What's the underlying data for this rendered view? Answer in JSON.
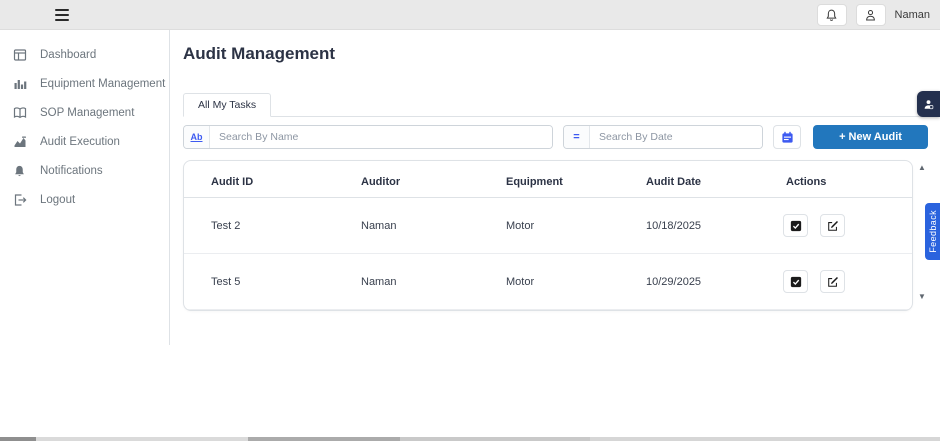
{
  "topbar": {
    "menu_icon": "hamburger-icon",
    "icons": [
      "bell-icon",
      "person-icon"
    ],
    "user_name": "Naman"
  },
  "sidebar": {
    "items": [
      {
        "label": "Dashboard",
        "icon": "dashboard-icon"
      },
      {
        "label": "Equipment Management",
        "icon": "equipment-bars-icon"
      },
      {
        "label": "SOP Management",
        "icon": "open-book-icon"
      },
      {
        "label": "Audit Execution",
        "icon": "audit-chart-icon"
      },
      {
        "label": "Notifications",
        "icon": "bell-filled-icon"
      },
      {
        "label": "Logout",
        "icon": "logout-icon"
      }
    ]
  },
  "main": {
    "title": "Audit Management",
    "tabs": [
      {
        "label": "All My Tasks",
        "active": true
      }
    ],
    "search_name": {
      "prefix": "Ab",
      "placeholder": "Search By Name"
    },
    "search_date": {
      "prefix": "=",
      "placeholder": "Search By Date"
    },
    "date_picker_icon": "calendar-icon",
    "new_audit_label": "+ New Audit",
    "table": {
      "columns": [
        "Audit ID",
        "Auditor",
        "Equipment",
        "Audit Date",
        "Actions"
      ],
      "rows": [
        {
          "audit_id": "Test 2",
          "auditor": "Naman",
          "equipment": "Motor",
          "audit_date": "10/18/2025"
        },
        {
          "audit_id": "Test 5",
          "auditor": "Naman",
          "equipment": "Motor",
          "audit_date": "10/29/2025"
        }
      ],
      "row_action_icons": [
        "check-square-icon",
        "edit-icon"
      ]
    }
  },
  "feedback_label": "Feedback",
  "colors": {
    "topbar_bg": "#e9e9e9",
    "border": "#dee2e6",
    "sidebar_text": "#6c757d",
    "heading_text": "#2c3345",
    "primary_button_blue": "#2277bd",
    "accent_blue": "#3d5af1",
    "feedback_blue": "#2a63de",
    "widget_navy": "#24304e"
  }
}
